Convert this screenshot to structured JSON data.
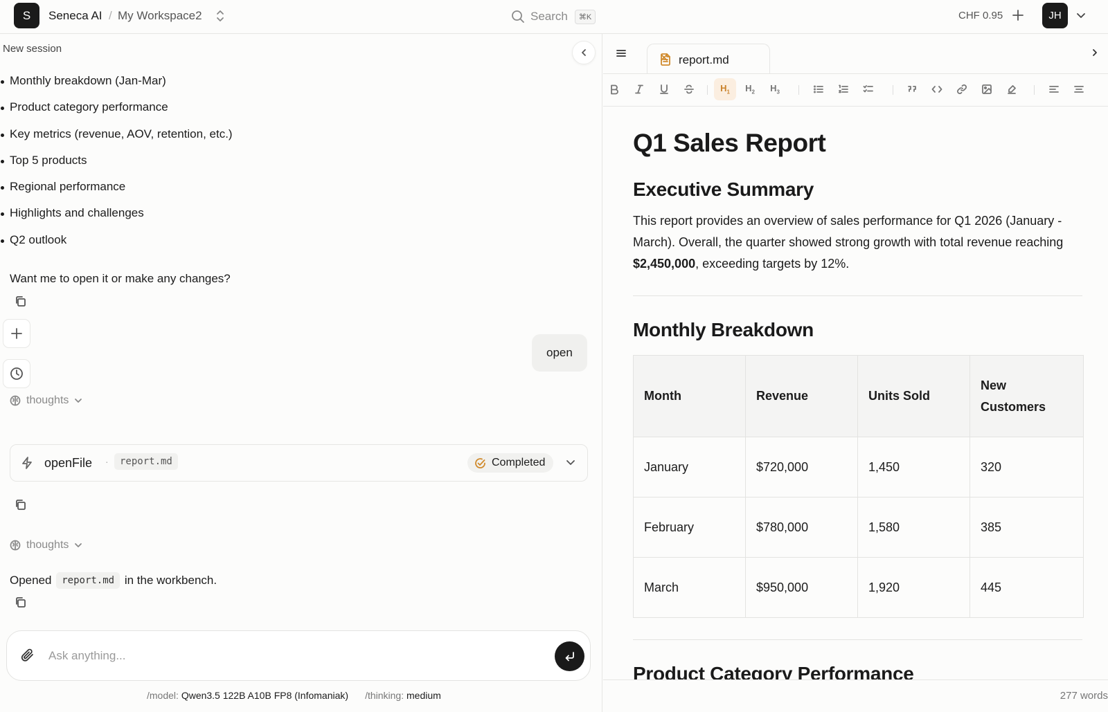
{
  "header": {
    "logo_letter": "S",
    "app_name": "Seneca AI",
    "breadcrumb_sep": "/",
    "workspace": "My Workspace2",
    "search_label": "Search",
    "search_shortcut": "⌘K",
    "credits": "CHF 0.95",
    "avatar_initials": "JH"
  },
  "chat": {
    "session_title": "New session",
    "bullets": [
      "Monthly breakdown (Jan-Mar)",
      "Product category performance",
      "Key metrics (revenue, AOV, retention, etc.)",
      "Top 5 products",
      "Regional performance",
      "Highlights and challenges",
      "Q2 outlook"
    ],
    "question": "Want me to open it or make any changes?",
    "user_message": "open",
    "thoughts_label": "thoughts",
    "tool": {
      "name": "openFile",
      "separator": "·",
      "file": "report.md",
      "status": "Completed"
    },
    "final_message": {
      "prefix": "Opened",
      "file": "report.md",
      "suffix": "in the workbench."
    },
    "composer_placeholder": "Ask anything...",
    "footer": {
      "model_key": "/model:",
      "model_value": "Qwen3.5 122B A10B FP8 (Infomaniak)",
      "thinking_key": "/thinking:",
      "thinking_value": "medium"
    }
  },
  "editor": {
    "tab_label": "report.md",
    "toolbar": {
      "active_heading": "H1",
      "headings": [
        {
          "letter": "H",
          "level": "1"
        },
        {
          "letter": "H",
          "level": "2"
        },
        {
          "letter": "H",
          "level": "3"
        }
      ]
    },
    "doc": {
      "title": "Q1 Sales Report",
      "section1": "Executive Summary",
      "summary_before": "This report provides an overview of sales performance for Q1 2026 (January - March). Overall, the quarter showed strong growth with total revenue reaching ",
      "summary_bold": "$2,450,000",
      "summary_after": ", exceeding targets by 12%.",
      "section2": "Monthly Breakdown",
      "table": {
        "headers": [
          "Month",
          "Revenue",
          "Units Sold",
          "New Customers"
        ],
        "rows": [
          [
            "January",
            "$720,000",
            "1,450",
            "320"
          ],
          [
            "February",
            "$780,000",
            "1,580",
            "385"
          ],
          [
            "March",
            "$950,000",
            "1,920",
            "445"
          ]
        ]
      },
      "section3": "Product Category Performance"
    },
    "word_count": "277 words"
  }
}
